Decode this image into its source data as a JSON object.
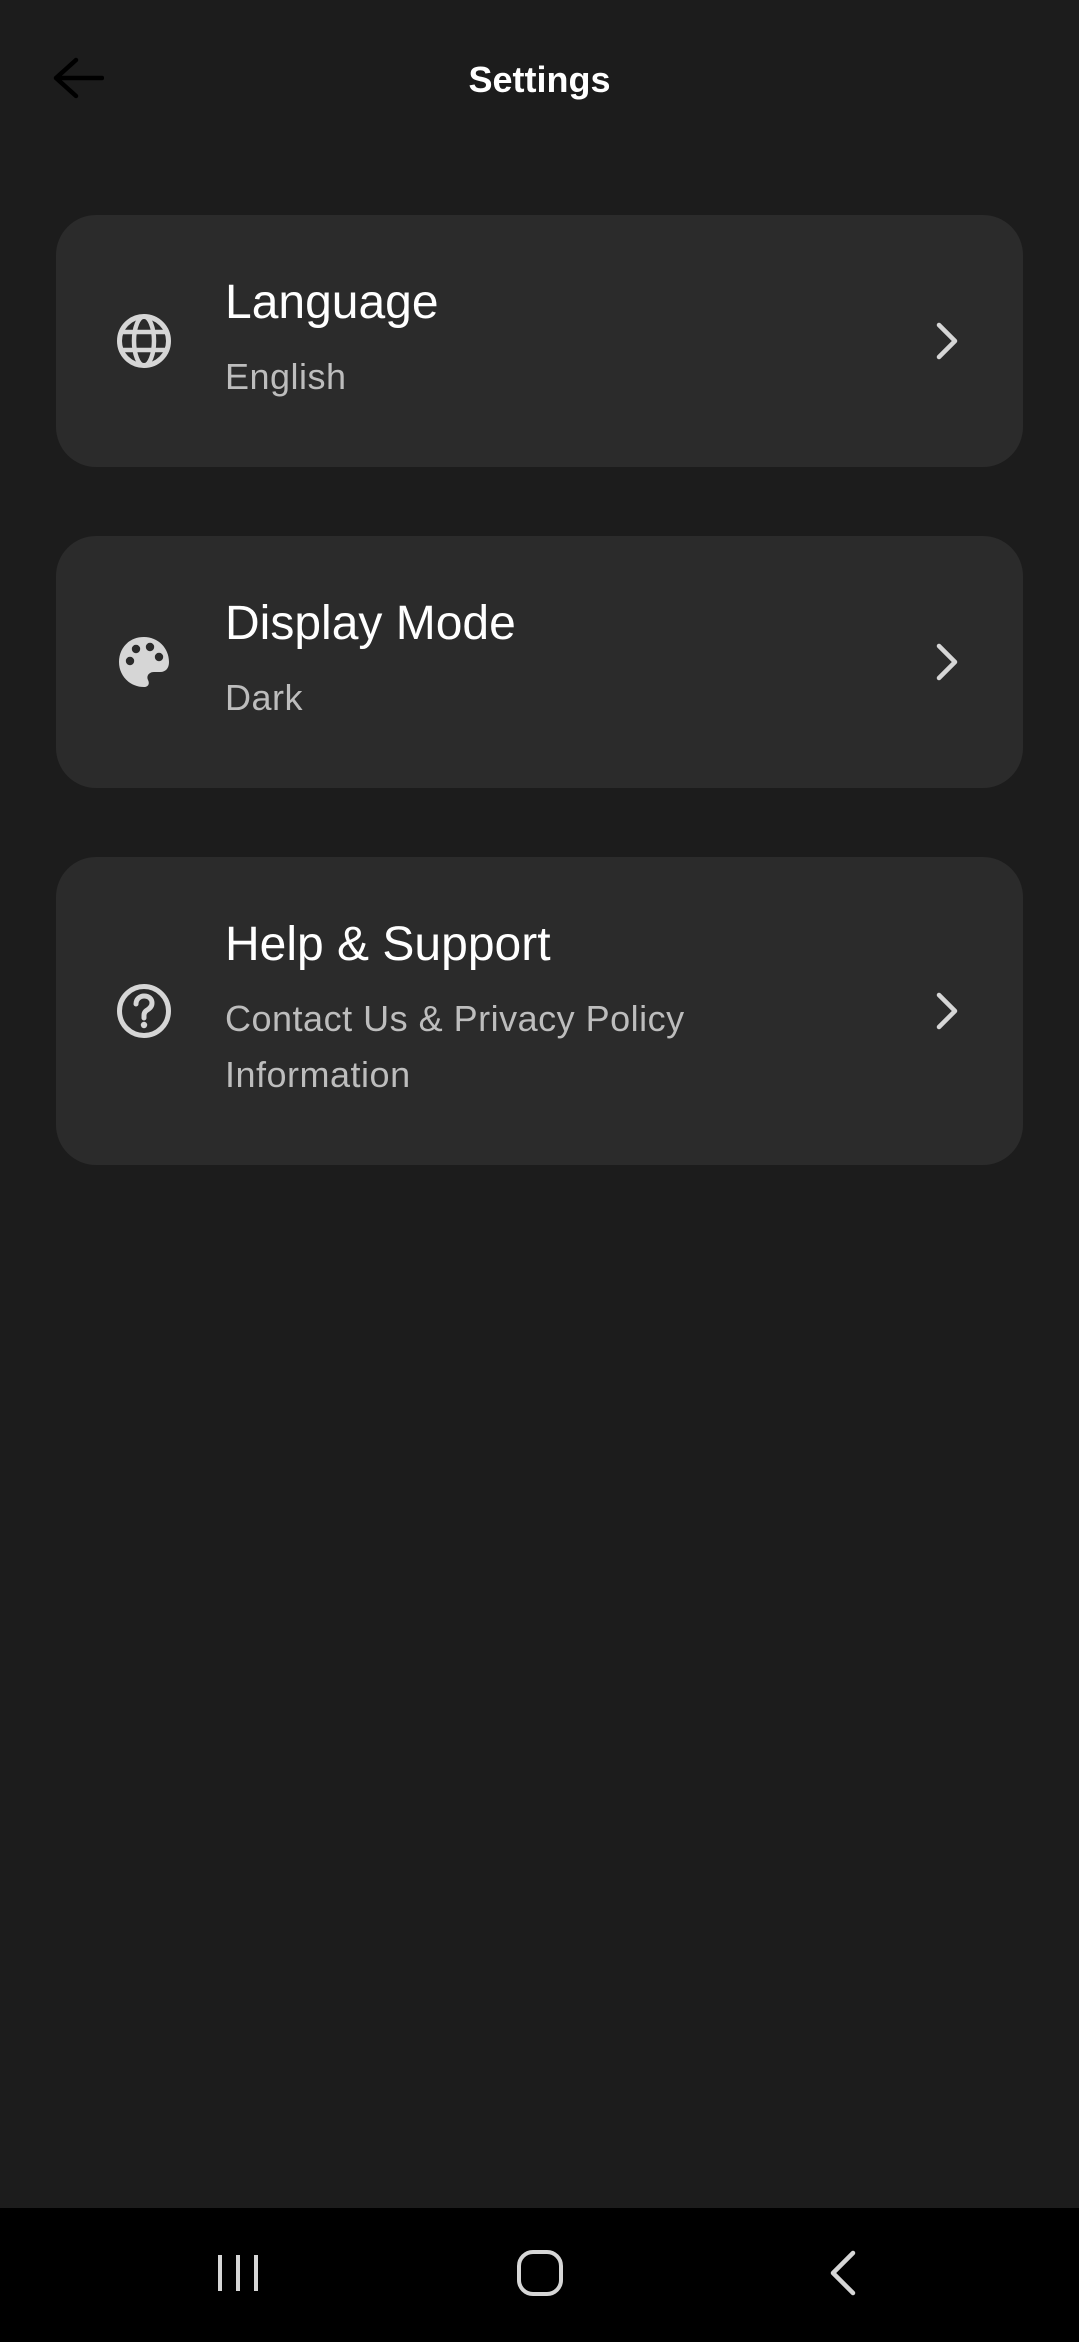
{
  "header": {
    "title": "Settings",
    "back_icon": "arrow-left-icon"
  },
  "settings": [
    {
      "icon": "globe-icon",
      "title": "Language",
      "subtitle": "English"
    },
    {
      "icon": "palette-icon",
      "title": "Display Mode",
      "subtitle": "Dark"
    },
    {
      "icon": "help-circle-icon",
      "title": "Help & Support",
      "subtitle": "Contact Us & Privacy Policy Information"
    }
  ],
  "navbar": {
    "recents_icon": "recents-icon",
    "home_icon": "home-icon",
    "back_icon": "back-icon"
  },
  "colors": {
    "background": "#1c1c1c",
    "card": "#2b2b2b",
    "title_text": "#ffffff",
    "subtitle_text": "#bdbdbd",
    "icon": "#d6d6d6",
    "navbar": "#000000"
  }
}
